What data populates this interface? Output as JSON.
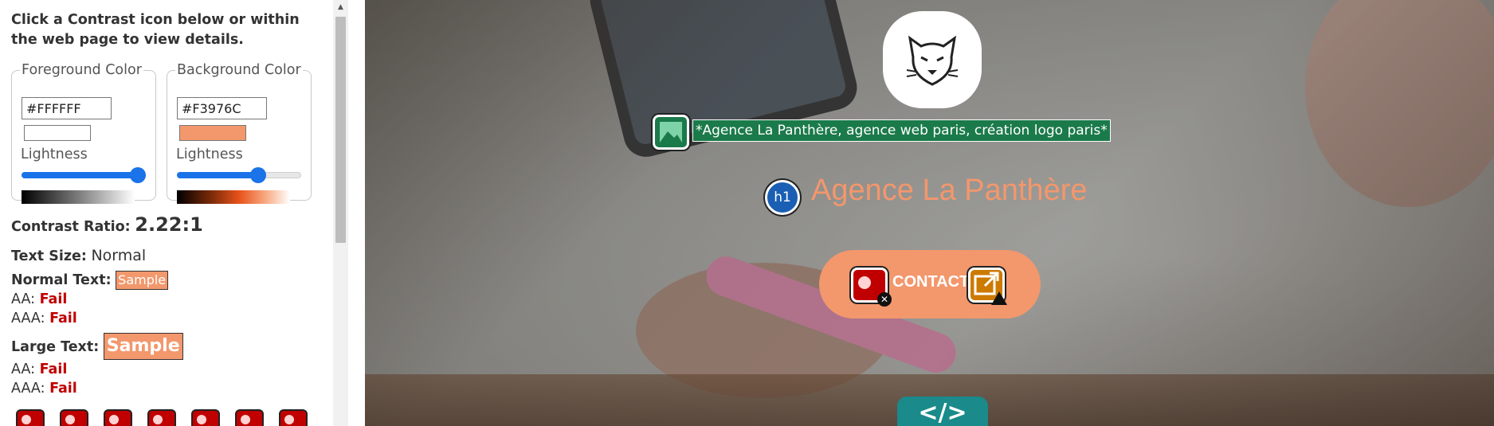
{
  "panel": {
    "instructions": "Click a Contrast icon below or within the web page to view details.",
    "foreground": {
      "legend": "Foreground Color",
      "hex": "#FFFFFF",
      "swatch_color": "#FFFFFF",
      "lightness_label": "Lightness",
      "lightness": 1.0
    },
    "background": {
      "legend": "Background Color",
      "hex": "#F3976C",
      "swatch_color": "#F3976C",
      "lightness_label": "Lightness",
      "lightness": 0.68
    },
    "contrast_ratio_label": "Contrast Ratio:",
    "contrast_ratio": "2.22:1",
    "text_size_label": "Text Size:",
    "text_size": "Normal",
    "normal_text_label": "Normal Text:",
    "large_text_label": "Large Text:",
    "sample": "Sample",
    "aa_label": "AA:",
    "aaa_label": "AAA:",
    "normal_aa": "Fail",
    "normal_aaa": "Fail",
    "large_aa": "Fail",
    "large_aaa": "Fail",
    "error_icon_count": 7
  },
  "site": {
    "image_alt": "*Agence La Panthère, agence web paris, création logo paris*",
    "h1_badge": "h1",
    "heading": "Agence La Panthère",
    "contact_label": "CONTACT",
    "code_toggle": "</>",
    "accent_color": "#F3976C"
  }
}
